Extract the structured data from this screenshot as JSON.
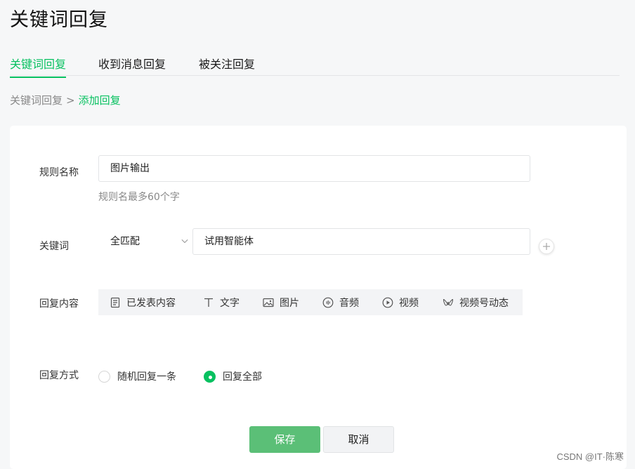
{
  "page_title": "关键词回复",
  "tabs": [
    {
      "label": "关键词回复",
      "active": true
    },
    {
      "label": "收到消息回复",
      "active": false
    },
    {
      "label": "被关注回复",
      "active": false
    }
  ],
  "breadcrumb": {
    "parent": "关键词回复",
    "separator": ">",
    "current": "添加回复"
  },
  "form": {
    "rule_name": {
      "label": "规则名称",
      "value": "图片输出",
      "hint": "规则名最多60个字"
    },
    "keyword": {
      "label": "关键词",
      "match_mode": "全匹配",
      "value": "试用智能体",
      "add_icon": "plus-circle-icon"
    },
    "reply_content": {
      "label": "回复内容",
      "options": [
        {
          "label": "已发表内容",
          "icon": "document-icon"
        },
        {
          "label": "文字",
          "icon": "text-icon"
        },
        {
          "label": "图片",
          "icon": "image-icon"
        },
        {
          "label": "音频",
          "icon": "audio-icon"
        },
        {
          "label": "视频",
          "icon": "video-play-icon"
        },
        {
          "label": "视频号动态",
          "icon": "channels-icon"
        }
      ]
    },
    "reply_mode": {
      "label": "回复方式",
      "options": [
        {
          "label": "随机回复一条",
          "selected": false
        },
        {
          "label": "回复全部",
          "selected": true
        }
      ]
    }
  },
  "actions": {
    "save_label": "保存",
    "cancel_label": "取消"
  },
  "watermark": "CSDN @IT·陈寒",
  "colors": {
    "accent": "#07c160",
    "save_button": "#5bbf77",
    "background": "#f6f7f8"
  }
}
